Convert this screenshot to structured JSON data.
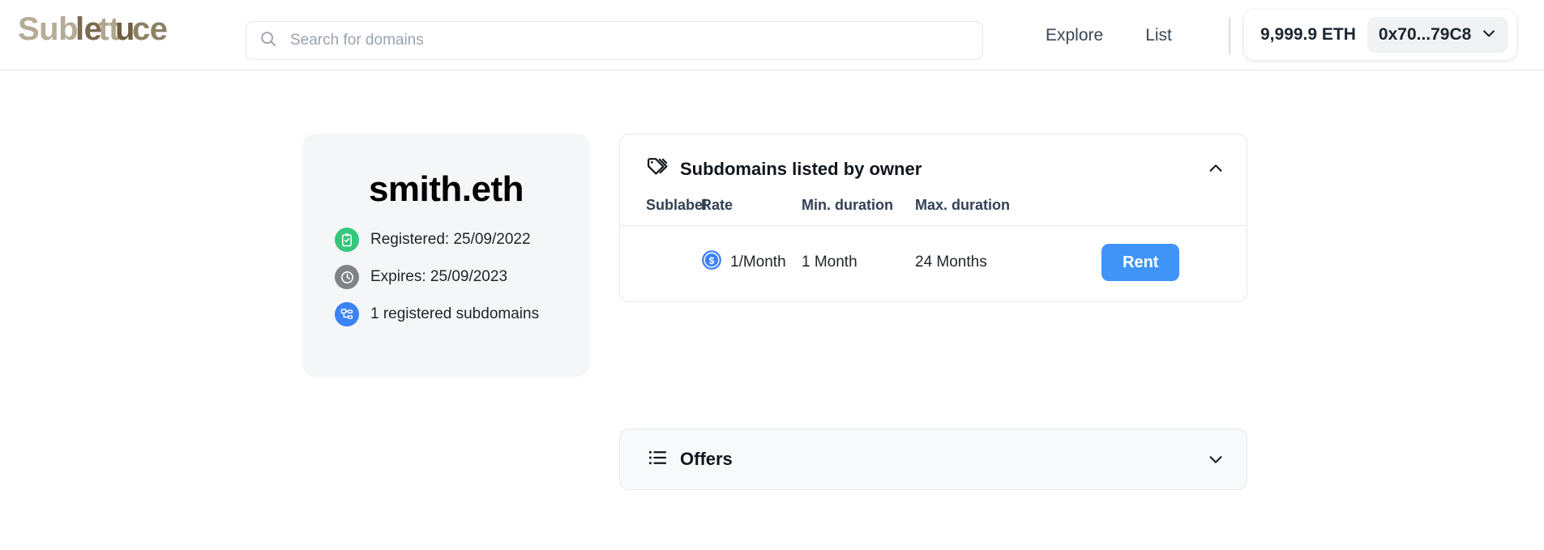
{
  "header": {
    "logo": {
      "full": "Sublettuce",
      "parts": [
        "Sub",
        "le",
        "tt",
        "u",
        "ce"
      ]
    },
    "search": {
      "placeholder": "Search for domains",
      "value": "",
      "icon": "search-icon"
    },
    "nav": [
      {
        "label": "Explore"
      },
      {
        "label": "List"
      }
    ],
    "wallet": {
      "balance": "9,999.9 ETH",
      "address": "0x70...79C8",
      "chevron_icon": "chevron-down-icon"
    }
  },
  "domain_card": {
    "name": "smith.eth",
    "meta": [
      {
        "icon": "clipboard-check-icon",
        "color": "#34c77b",
        "text": "Registered: 25/09/2022"
      },
      {
        "icon": "clock-icon",
        "color": "#7f8388",
        "text": "Expires: 25/09/2023"
      },
      {
        "icon": "sitemap-icon",
        "color": "#3b82f6",
        "text": "1 registered subdomains"
      }
    ]
  },
  "subdomains_panel": {
    "icon": "tags-icon",
    "title": "Subdomains listed by owner",
    "expanded": true,
    "toggle_icon": "chevron-up-icon",
    "columns": [
      "Sublabel",
      "Rate",
      "Min. duration",
      "Max. duration",
      ""
    ],
    "rows": [
      {
        "sublabel": "",
        "rate_icon": "usdc-coin-icon",
        "rate": "1/Month",
        "min_duration": "1 Month",
        "max_duration": "24 Months",
        "action_label": "Rent"
      }
    ]
  },
  "offers_panel": {
    "icon": "list-icon",
    "title": "Offers",
    "expanded": false,
    "toggle_icon": "chevron-down-icon"
  },
  "colors": {
    "accent_blue": "#4094f7",
    "success_green": "#34c77b",
    "neutral_gray": "#7f8388",
    "card_bg": "#f5f6f8",
    "offers_bg": "#f7f9fb"
  }
}
